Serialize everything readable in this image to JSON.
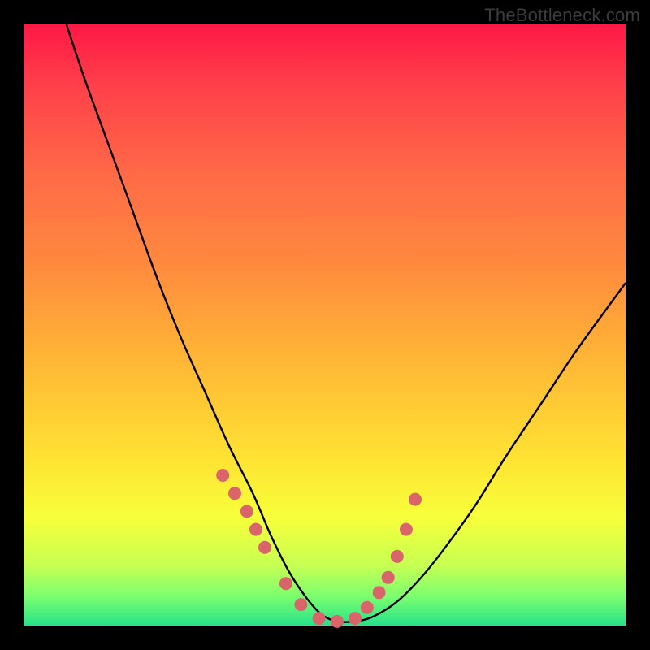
{
  "watermark": "TheBottleneck.com",
  "chart_data": {
    "type": "line",
    "title": "",
    "xlabel": "",
    "ylabel": "",
    "xlim": [
      0,
      100
    ],
    "ylim": [
      0,
      100
    ],
    "grid": false,
    "legend": false,
    "background_gradient": [
      "#ff1846",
      "#ff6a47",
      "#ffb436",
      "#ffe233",
      "#c7ff52",
      "#25e28a"
    ],
    "series": [
      {
        "name": "curve",
        "style": "line",
        "color": "#000000",
        "x": [
          7,
          10,
          14,
          18,
          22,
          26,
          30,
          34,
          38,
          41,
          44,
          47,
          49.5,
          52,
          55,
          58,
          62,
          66,
          70,
          75,
          80,
          86,
          92,
          100
        ],
        "y": [
          100,
          91,
          80,
          69,
          58,
          48,
          39,
          30,
          22,
          15,
          9,
          4.5,
          1.8,
          0.7,
          0.7,
          1.5,
          4,
          8,
          13,
          20,
          28,
          37,
          46,
          57
        ]
      },
      {
        "name": "points",
        "style": "scatter",
        "color": "#d9656a",
        "x": [
          33,
          35,
          37,
          38.5,
          40,
          43.5,
          46,
          49,
          52,
          55,
          57,
          59,
          60.5,
          62,
          63.5,
          65
        ],
        "y": [
          25,
          22,
          19,
          16,
          13,
          7,
          3.5,
          1.2,
          0.7,
          1.2,
          3,
          5.5,
          8,
          11.5,
          16,
          21
        ]
      }
    ],
    "annotations": []
  }
}
